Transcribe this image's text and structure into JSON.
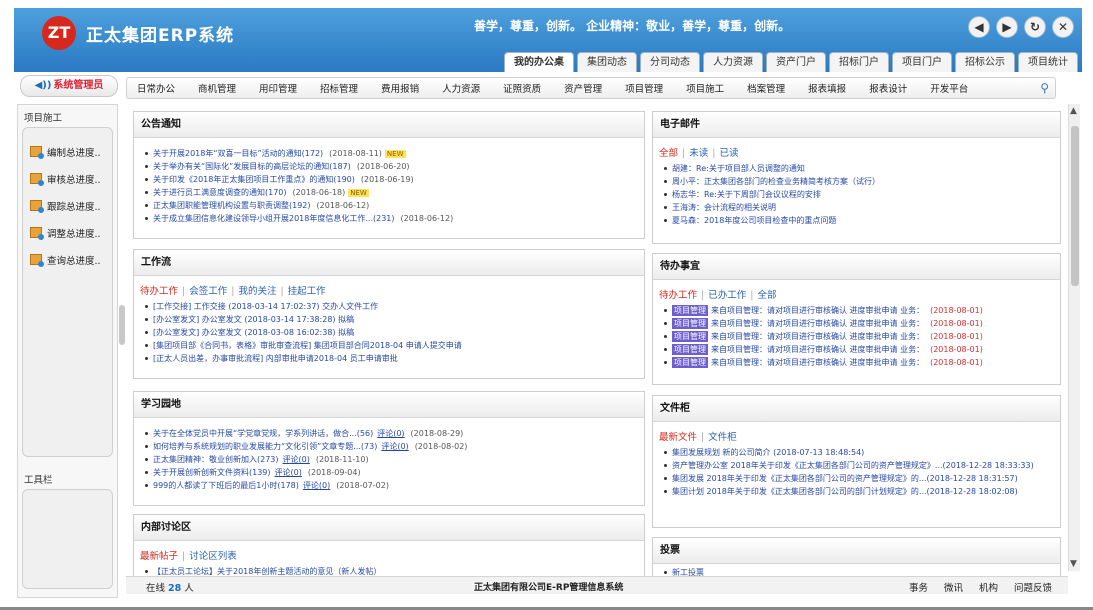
{
  "header": {
    "logo_text": "ZT",
    "title": "正太集团ERP系统",
    "motto": "善学，尊重，创新。  企业精神：敬业，善学，尊重，创新。",
    "window_buttons": [
      "back-icon",
      "forward-icon",
      "refresh-icon",
      "close-icon"
    ],
    "window_glyphs": [
      "◀",
      "▶",
      "↻",
      "✕"
    ],
    "top_tabs": [
      "我的办公桌",
      "集团动态",
      "分司动态",
      "人力资源",
      "资产门户",
      "招标门户",
      "项目门户",
      "招标公示",
      "项目统计"
    ],
    "active_tab": "我的办公桌"
  },
  "admin": {
    "label": "系统管理员",
    "icon": "speaker-icon"
  },
  "module_nav": {
    "items": [
      "日常办公",
      "商机管理",
      "用印管理",
      "招标管理",
      "费用报销",
      "人力资源",
      "证照资质",
      "资产管理",
      "项目管理",
      "项目施工",
      "档案管理",
      "报表填报",
      "报表设计",
      "开发平台"
    ],
    "search_icon": "search-icon"
  },
  "sidebar": {
    "section_title": "项目施工",
    "items": [
      "编制总进度..",
      "审核总进度..",
      "跟踪总进度..",
      "调整总进度..",
      "查询总进度.."
    ],
    "toolbar_title": "工具栏"
  },
  "panels": {
    "notice": {
      "title": "公告通知",
      "rows": [
        {
          "text": "关于开展2018年“双喜一目标”活动的通知(172)",
          "date": "(2018-08-11)",
          "new": "NEW"
        },
        {
          "text": "关于举办有关“国际化”发展目标的高层论坛的通知(187)",
          "date": "(2018-06-20)"
        },
        {
          "text": "关于印发《2018年正太集团项目工作重点》的通知(190)",
          "date": "(2018-06-19)"
        },
        {
          "text": "关于进行员工满意度调查的通知(170)",
          "date": "(2018-06-18)",
          "new": "NEW"
        },
        {
          "text": "正太集团职能管理机构设置与职责调整(192)",
          "date": "(2018-06-12)"
        },
        {
          "text": "关于成立集团信息化建设领导小组开展2018年度信息化工作...(231)",
          "date": "(2018-06-12)"
        }
      ]
    },
    "mail": {
      "title": "电子邮件",
      "tabs": [
        "全部",
        "未读",
        "已读"
      ],
      "rows": [
        "胡建：Re:关于项目部人员调整的通知",
        "周小平：正太集团各部门的检查业务精简考核方案（试行）",
        "杨志华：Re:关于下周部门会议议程的安排",
        "王海涛：会计流程的相关说明",
        "夏马森：2018年度公司项目检查中的重点问题"
      ]
    },
    "workflow": {
      "title": "工作流",
      "tabs": [
        "待办工作",
        "会签工作",
        "我的关注",
        "挂起工作"
      ],
      "rows": [
        "[工作交接] 工作交接 (2018-03-14 17:02:37) 交办人文件工作",
        "[办公室发文] 办公室发文 (2018-03-14 17:38:28) 拟稿",
        "[办公室发文] 办公室发文 (2018-03-08 16:02:38) 拟稿",
        "[集团项目部《合同书，表格》审批审查流程] 集团项目部合同2018-04 申请人提交申请",
        "[正太人员出差，办事审批流程] 内部审批申请2018-04 员工申请审批"
      ]
    },
    "todo": {
      "title": "待办事宜",
      "tabs": [
        "待办工作",
        "已办工作",
        "全部"
      ],
      "rows": [
        {
          "chip": "项目管理",
          "text": "来自项目管理：请对项目进行审核确认 进度审批申请 业务：",
          "date": "(2018-08-01)"
        },
        {
          "chip": "项目管理",
          "text": "来自项目管理：请对项目进行审核确认 进度审批申请 业务：",
          "date": "(2018-08-01)"
        },
        {
          "chip": "项目管理",
          "text": "来自项目管理：请对项目进行审核确认 进度审批申请 业务：",
          "date": "(2018-08-01)"
        },
        {
          "chip": "项目管理",
          "text": "来自项目管理：请对项目进行审核确认 进度审批申请 业务：",
          "date": "(2018-08-01)"
        },
        {
          "chip": "项目管理",
          "text": "来自项目管理：请对项目进行审核确认 进度审批申请 业务：",
          "date": "(2018-08-01)"
        }
      ]
    },
    "study": {
      "title": "学习园地",
      "rows": [
        {
          "text": "关于在全体党员中开展“学党章党规，学系列讲话，做合...(56)",
          "link": "评论(0)",
          "date": "(2018-08-29)"
        },
        {
          "text": "如何培养与系统规划的职业发展能力“文化引领”文章专题...(73)",
          "link": "评论(0)",
          "date": "(2018-08-02)"
        },
        {
          "text": "正太集团精神：敬业创新加入(273)",
          "link": "评论(0)",
          "date": "(2018-11-10)"
        },
        {
          "text": "关于开展创新创新文件资料(139)",
          "link": "评论(0)",
          "date": "(2018-09-04)"
        },
        {
          "text": "999的人都读了下班后的最后1小时(178)",
          "link": "评论(0)",
          "date": "(2018-07-02)"
        }
      ]
    },
    "filecab": {
      "title": "文件柜",
      "tabs": [
        "最新文件",
        "文件柜"
      ],
      "rows": [
        "集团发展规划 新的公司简介 (2018-07-13 18:48:54)",
        "资产管理办公室 2018年关于印发《正太集团各部门公司的资产管理规定》...(2018-12-28 18:33:33)",
        "集团发展 2018年关于印发《正太集团各部门公司的资产管理规定》的...(2018-12-28 18:31:57)",
        "集团计划 2018年关于印发《正太集团各部门公司的部门计划规定》的...(2018-12-28 18:02:08)"
      ]
    },
    "forum": {
      "title": "内部讨论区",
      "tabs": [
        "最新帖子",
        "讨论区列表"
      ],
      "rows": [
        "【正太员工论坛】关于2018年创新主题活动的意见（新人发帖）"
      ]
    },
    "vote": {
      "title": "投票",
      "rows": [
        "新工投票"
      ]
    }
  },
  "footer": {
    "online_label": "在线",
    "online_count": "28",
    "online_unit": "人",
    "company": "正太集团有限公司E-RP管理信息系统",
    "links": [
      "事务",
      "微讯",
      "机构",
      "问题反馈"
    ]
  },
  "colors": {
    "header_blue": "#2a79c4",
    "link_blue": "#2749a6",
    "accent_red": "#d42a1e"
  }
}
